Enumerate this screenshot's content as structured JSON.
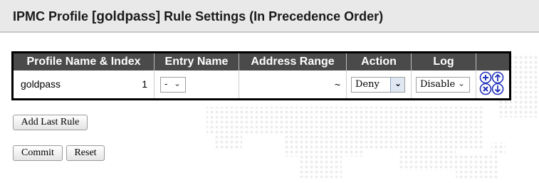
{
  "header": {
    "title_prefix": "IPMC Profile ",
    "profile_name": "[goldpass]",
    "title_suffix": " Rule Settings (In Precedence Order)"
  },
  "table": {
    "columns": [
      "Profile Name & Index",
      "Entry Name",
      "Address Range",
      "Action",
      "Log"
    ],
    "rows": [
      {
        "profile_name": "goldpass",
        "index": "1",
        "entry_name": "-",
        "address_range": "~",
        "action": "Deny",
        "log": "Disable"
      }
    ]
  },
  "icons": {
    "insert": "insert-icon",
    "move_up": "move-up-icon",
    "delete": "delete-icon",
    "move_down": "move-down-icon",
    "accent": "#2233bb"
  },
  "buttons": {
    "add_last_rule": "Add Last Rule",
    "commit": "Commit",
    "reset": "Reset"
  }
}
